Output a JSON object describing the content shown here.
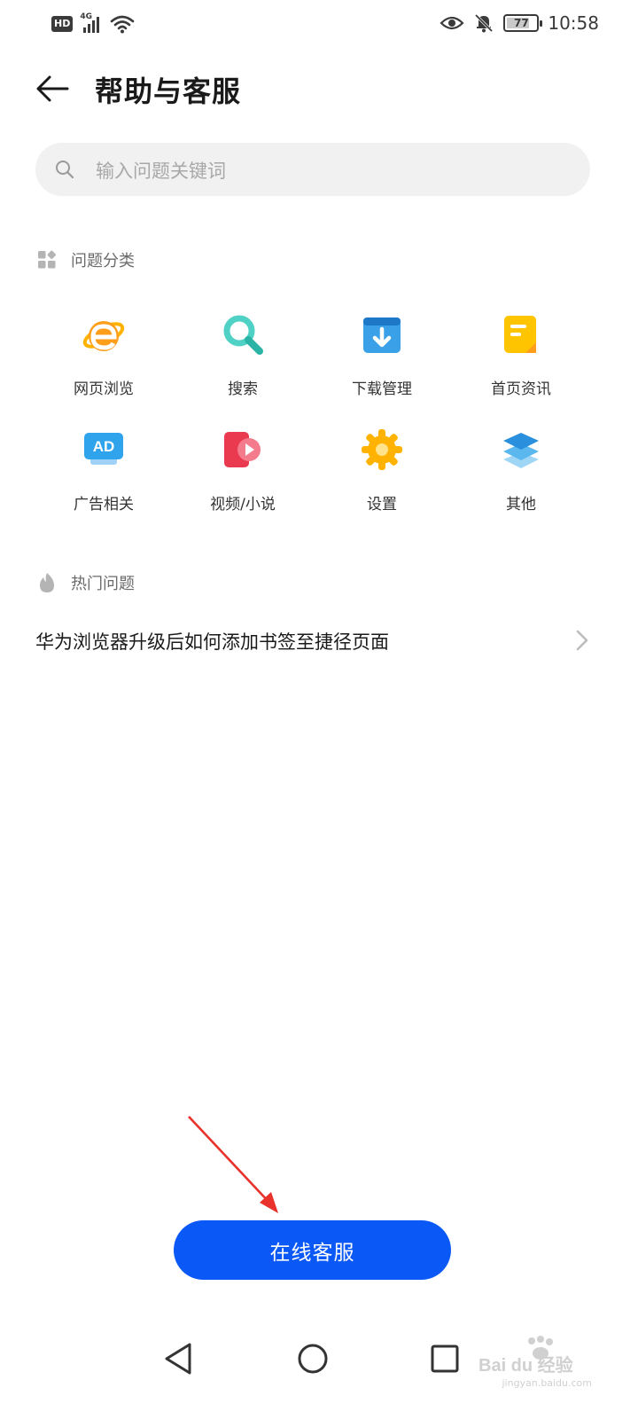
{
  "status_bar": {
    "network_badge": "HD",
    "network_type": "4G",
    "battery_level": "77",
    "time": "10:58"
  },
  "header": {
    "title": "帮助与客服"
  },
  "search": {
    "placeholder": "输入问题关键词"
  },
  "categories_section": {
    "title": "问题分类",
    "items": [
      {
        "label": "网页浏览",
        "icon": "browser-e-icon"
      },
      {
        "label": "搜索",
        "icon": "magnifier-icon"
      },
      {
        "label": "下载管理",
        "icon": "download-icon"
      },
      {
        "label": "首页资讯",
        "icon": "news-document-icon"
      },
      {
        "label": "广告相关",
        "icon": "ad-icon"
      },
      {
        "label": "视频/小说",
        "icon": "video-play-icon"
      },
      {
        "label": "设置",
        "icon": "gear-icon"
      },
      {
        "label": "其他",
        "icon": "layers-icon"
      }
    ]
  },
  "hot_section": {
    "title": "热门问题",
    "items": [
      {
        "text": "华为浏览器升级后如何添加书签至捷径页面"
      }
    ]
  },
  "online_service_button": {
    "label": "在线客服"
  },
  "watermark": {
    "brand": "Bai du 经验",
    "url": "jingyan.baidu.com"
  },
  "colors": {
    "primary": "#0a59f7",
    "annotation_arrow": "#e8322b"
  }
}
